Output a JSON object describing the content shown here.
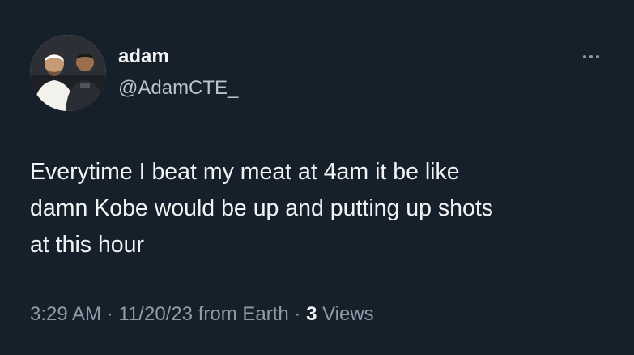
{
  "colors": {
    "background": "#15202b",
    "primary_text": "#e7e9ea",
    "secondary_text": "#8b98a5"
  },
  "author": {
    "display_name": "adam",
    "handle": "@AdamCTE_",
    "avatar_icon": "profile-photo-two-men"
  },
  "more_icon": "more-horizontal-icon",
  "tweet": {
    "text": "Everytime I beat my meat at 4am it be like\ndamn Kobe would be up and putting up shots\nat this hour"
  },
  "meta": {
    "time": "3:29 AM",
    "sep1": " · ",
    "date": "11/20/23",
    "source": " from Earth",
    "sep2": " · ",
    "views_count": "3",
    "views_label": " Views"
  }
}
